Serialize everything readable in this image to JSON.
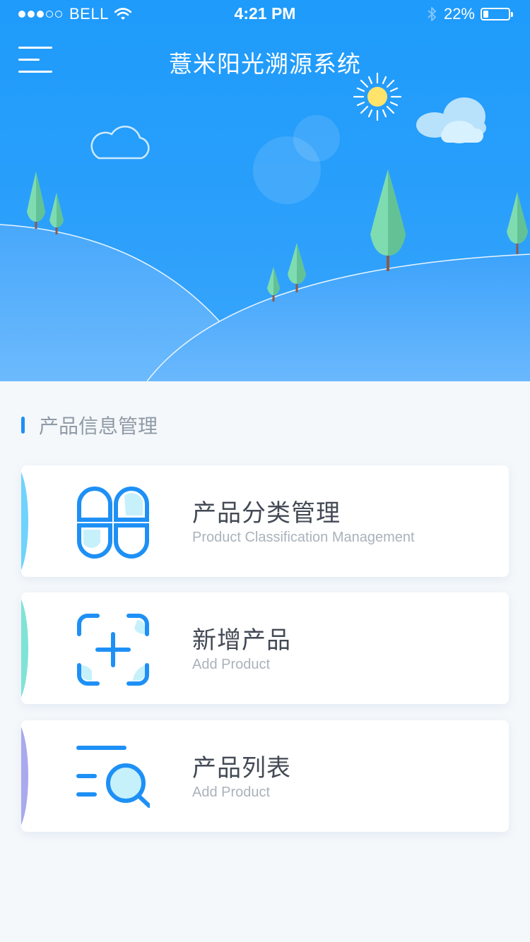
{
  "status_bar": {
    "carrier": "BELL",
    "time": "4:21 PM",
    "battery_percent": "22%",
    "battery_level": 0.22
  },
  "header": {
    "title": "薏米阳光溯源系统",
    "menu_icon": "menu-icon"
  },
  "section": {
    "title": "产品信息管理"
  },
  "cards": [
    {
      "title": "产品分类管理",
      "subtitle": "Product Classification Management",
      "icon": "classification-icon",
      "accent": "#6fd3fb"
    },
    {
      "title": "新增产品",
      "subtitle": "Add Product",
      "icon": "add-product-icon",
      "accent": "#7fe3d6"
    },
    {
      "title": "产品列表",
      "subtitle": "Add Product",
      "icon": "product-list-icon",
      "accent": "#a9a9ee"
    }
  ],
  "colors": {
    "brand_blue": "#1e9bfb",
    "icon_blue": "#1e90f5",
    "icon_fill": "#c6f1fb",
    "background": "#f5f8fb"
  }
}
